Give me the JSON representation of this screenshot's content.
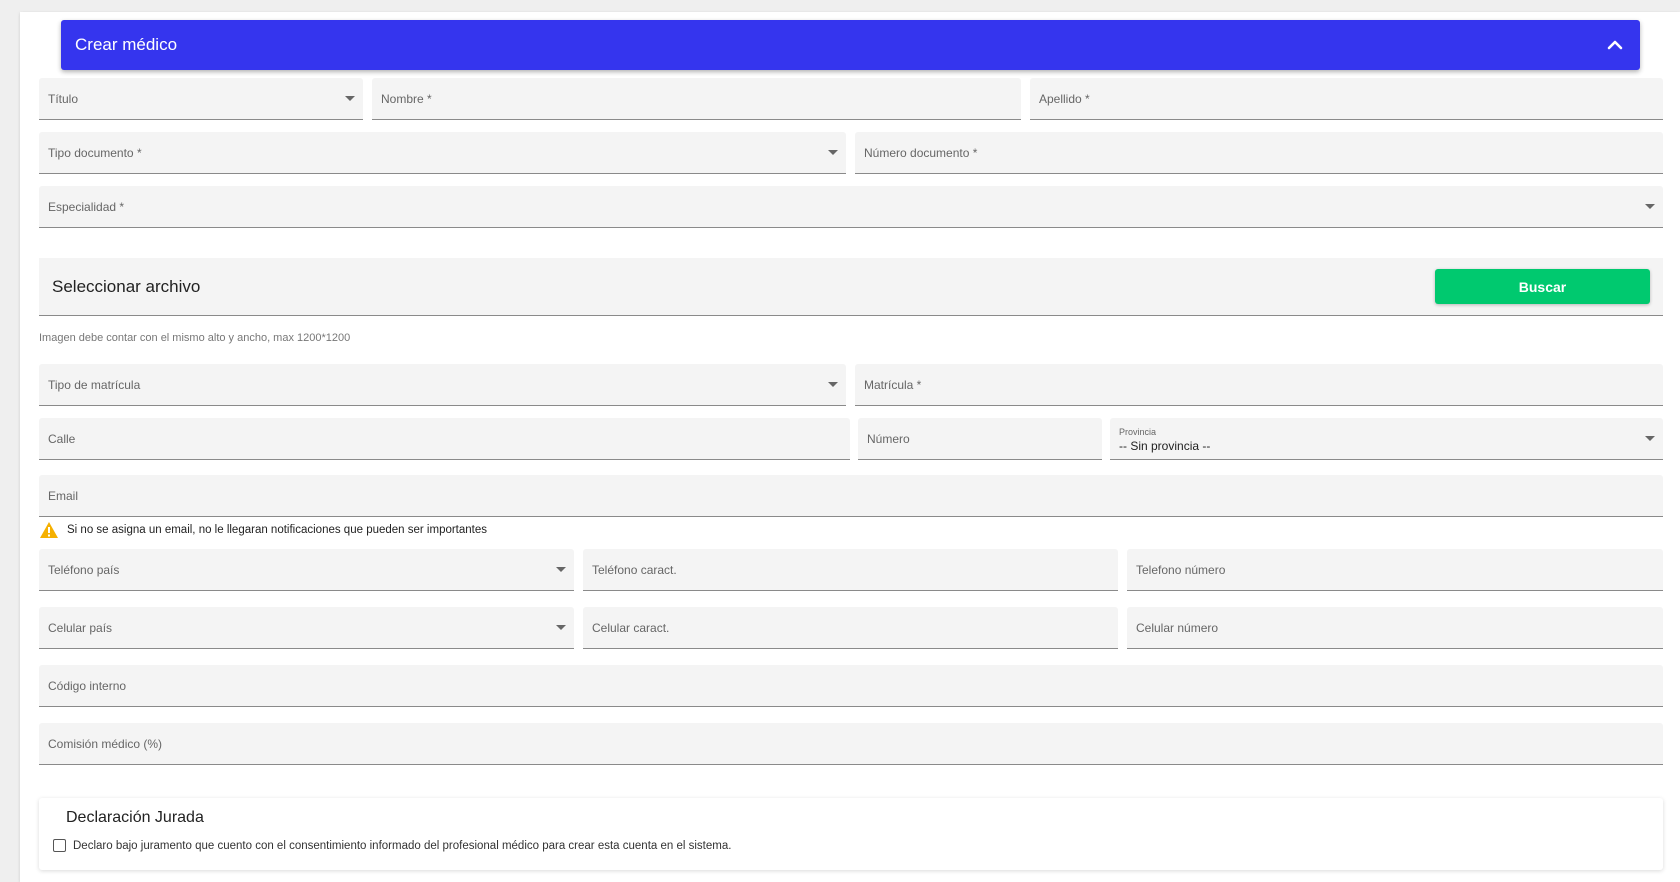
{
  "header": {
    "title": "Crear médico"
  },
  "fields": {
    "titulo": "Título",
    "nombre": "Nombre *",
    "apellido": "Apellido *",
    "tipo_documento": "Tipo documento *",
    "numero_documento": "Número documento *",
    "especialidad": "Especialidad *",
    "tipo_matricula": "Tipo de matrícula",
    "matricula": "Matrícula *",
    "calle": "Calle",
    "numero": "Número",
    "provincia_label": "Provincia",
    "provincia_value": "-- Sin provincia --",
    "email": "Email",
    "telefono_pais": "Teléfono país",
    "telefono_caract": "Teléfono caract.",
    "telefono_numero": "Telefono número",
    "celular_pais": "Celular país",
    "celular_caract": "Celular caract.",
    "celular_numero": "Celular número",
    "codigo_interno": "Código interno",
    "comision": "Comisión médico (%)"
  },
  "file": {
    "title": "Seleccionar archivo",
    "button": "Buscar",
    "hint": "Imagen debe contar con el mismo alto y ancho, max 1200*1200"
  },
  "warning": {
    "text": "Si no se asigna un email, no le llegaran notificaciones que pueden ser importantes"
  },
  "declaracion": {
    "title": "Declaración Jurada",
    "checkbox_label": "Declaro bajo juramento que cuento con el consentimiento informado del profesional médico para crear esta cuenta en el sistema.",
    "checked": false
  },
  "colors": {
    "header_bg": "#3535ee",
    "button_bg": "#00c96f",
    "warning_icon": "#f5b000"
  }
}
